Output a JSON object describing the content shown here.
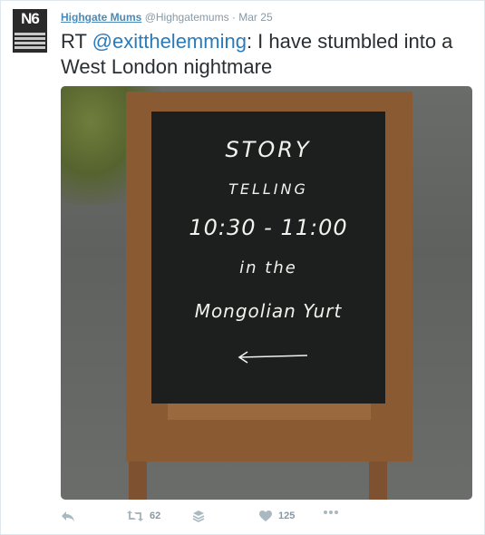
{
  "tweet": {
    "avatar_label": "N6",
    "name": "Highgate Mums",
    "handle": "@Highgatemums",
    "separator": "·",
    "date": "Mar 25",
    "text_prefix": "RT ",
    "mention": "@exitthelemming",
    "text_rest": ": I have stumbled into a West London nightmare"
  },
  "photo": {
    "lines": [
      "STORY",
      "TELLING",
      "10:30 - 11:00",
      "in the",
      "Mongolian Yurt"
    ],
    "arrow": "←"
  },
  "actions": {
    "reply_icon": "reply-icon",
    "retweet_icon": "retweet-icon",
    "retweet_count": "62",
    "buffer_icon": "buffer-icon",
    "like_icon": "heart-icon",
    "like_count": "125",
    "more_icon": "more-icon"
  }
}
